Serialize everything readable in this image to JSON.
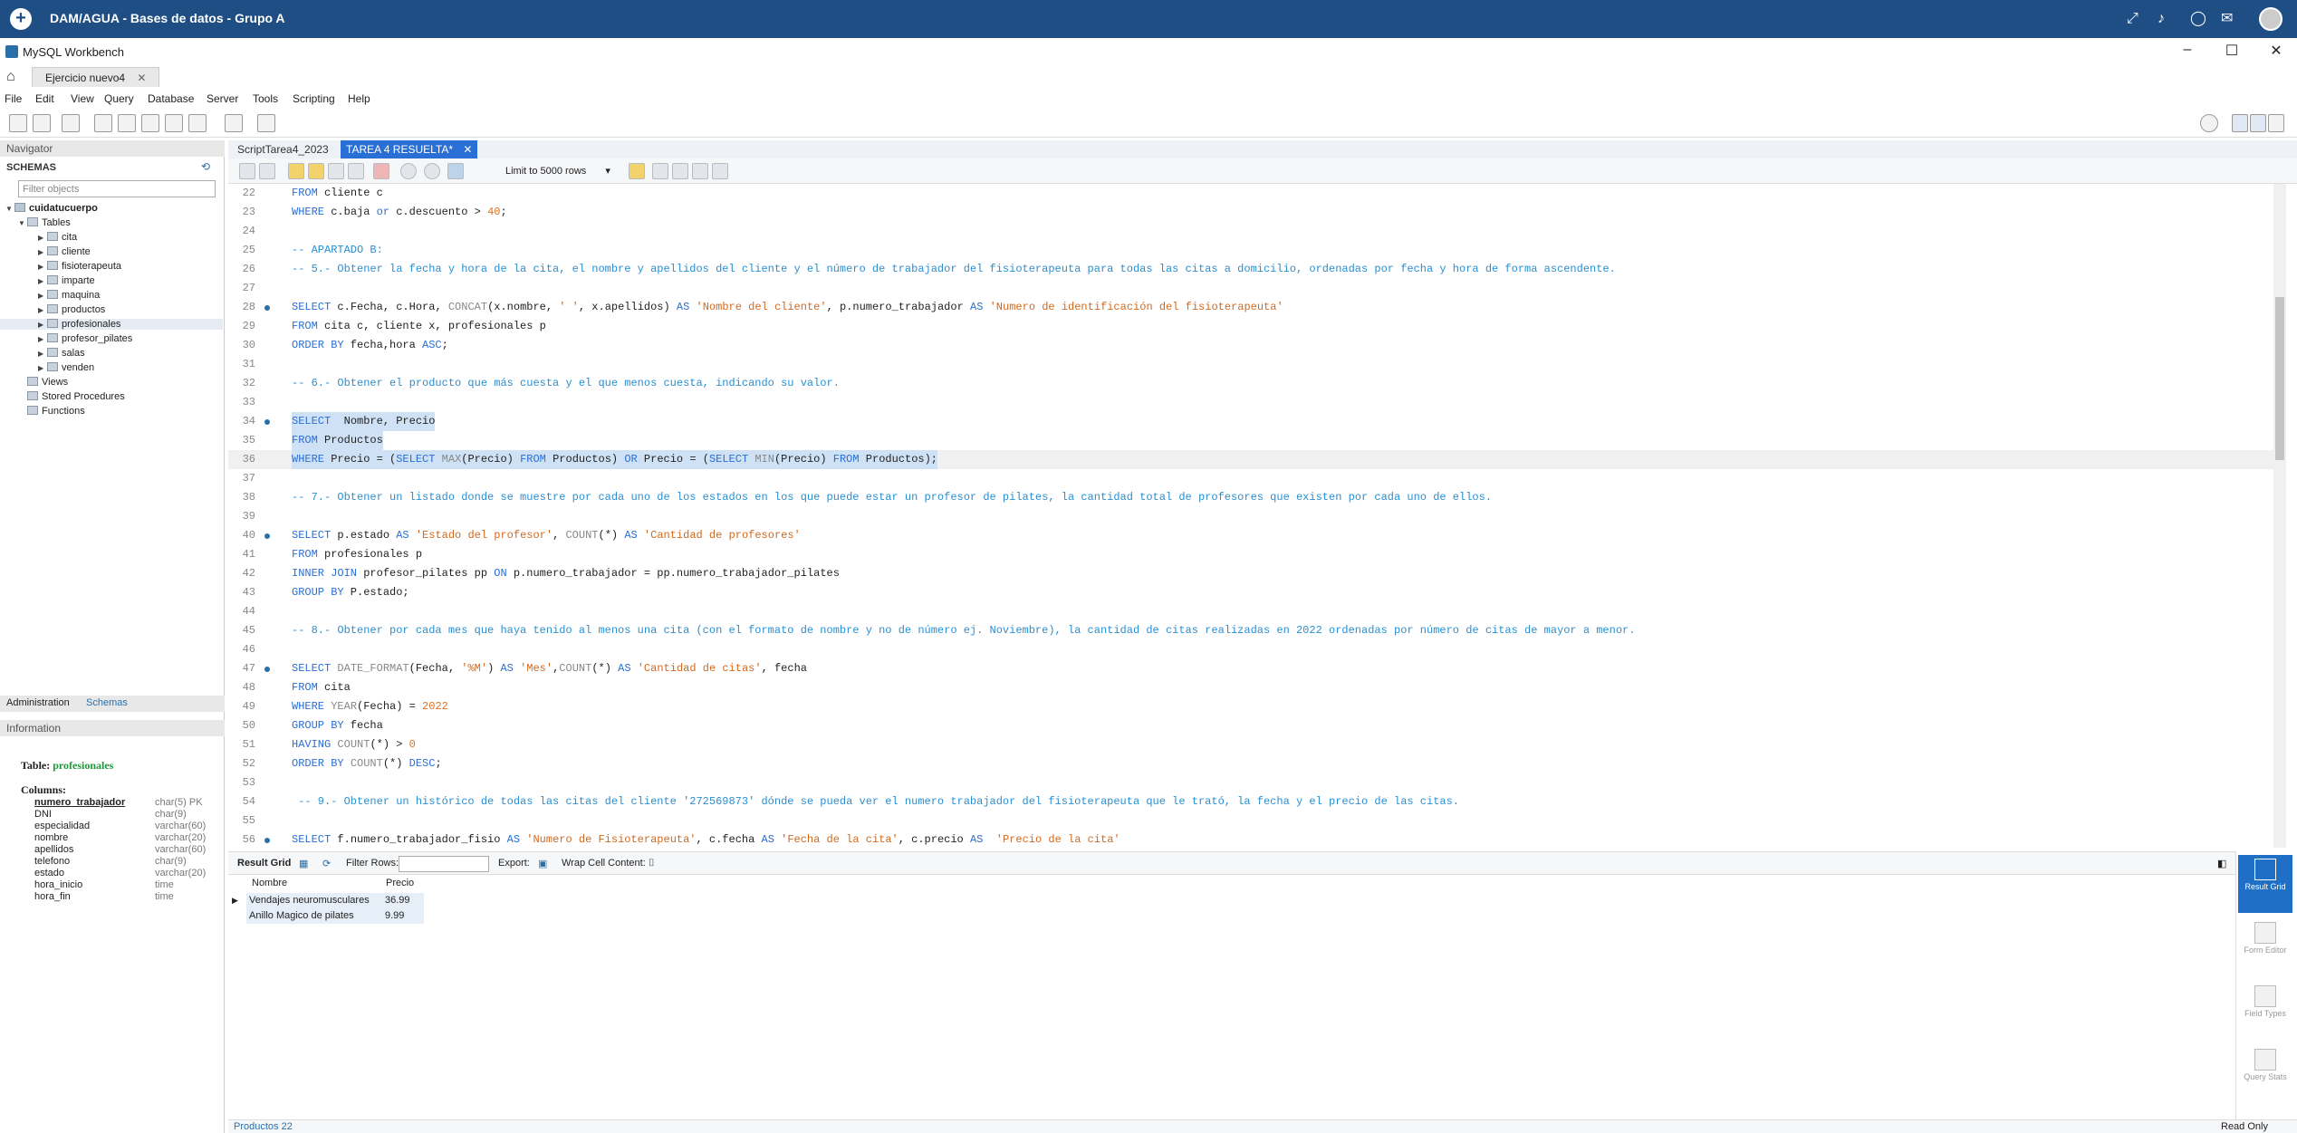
{
  "topbar": {
    "title": "DAM/AGUA - Bases de datos - Grupo A"
  },
  "window": {
    "app_title": "MySQL Workbench",
    "doc_tab": "Ejercicio nuevo4"
  },
  "menu": [
    "File",
    "Edit",
    "View",
    "Query",
    "Database",
    "Server",
    "Tools",
    "Scripting",
    "Help"
  ],
  "navigator": {
    "header": "Navigator",
    "schemas_title": "SCHEMAS",
    "filter_placeholder": "Filter objects",
    "schema": "cuidatucuerpo",
    "tables_label": "Tables",
    "tables": [
      "cita",
      "cliente",
      "fisioterapeuta",
      "imparte",
      "maquina",
      "productos",
      "profesionales",
      "profesor_pilates",
      "salas",
      "venden"
    ],
    "views": "Views",
    "procedures": "Stored Procedures",
    "functions": "Functions"
  },
  "panel_tabs": {
    "administration": "Administration",
    "schemas": "Schemas",
    "information": "Information"
  },
  "info": {
    "table_label": "Table:",
    "table_name": "profesionales",
    "columns_label": "Columns:",
    "columns": [
      {
        "name": "numero_trabajador",
        "type": "char(5) PK"
      },
      {
        "name": "DNI",
        "type": "char(9)"
      },
      {
        "name": "especialidad",
        "type": "varchar(60)"
      },
      {
        "name": "nombre",
        "type": "varchar(20)"
      },
      {
        "name": "apellidos",
        "type": "varchar(60)"
      },
      {
        "name": "telefono",
        "type": "char(9)"
      },
      {
        "name": "estado",
        "type": "varchar(20)"
      },
      {
        "name": "hora_inicio",
        "type": "time"
      },
      {
        "name": "hora_fin",
        "type": "time"
      }
    ]
  },
  "editor_tabs": [
    "ScriptTarea4_2023",
    "TAREA 4 RESUELTA*"
  ],
  "editor_toolbar": {
    "limit": "Limit to 5000 rows"
  },
  "code_lines": [
    {
      "n": "22",
      "dot": false,
      "t": "FROM cliente c"
    },
    {
      "n": "23",
      "dot": false,
      "t": "WHERE c.baja or c.descuento > 40;"
    },
    {
      "n": "24",
      "dot": false,
      "t": ""
    },
    {
      "n": "25",
      "dot": false,
      "t": "-- APARTADO B:"
    },
    {
      "n": "26",
      "dot": false,
      "t": "-- 5.- Obtener la fecha y hora de la cita, el nombre y apellidos del cliente y el número de trabajador del fisioterapeuta para todas las citas a domicilio, ordenadas por fecha y hora de forma ascendente."
    },
    {
      "n": "27",
      "dot": false,
      "t": ""
    },
    {
      "n": "28",
      "dot": true,
      "t": "SELECT c.Fecha, c.Hora, CONCAT(x.nombre, ' ', x.apellidos) AS 'Nombre del cliente', p.numero_trabajador AS 'Numero de identificación del fisioterapeuta'"
    },
    {
      "n": "29",
      "dot": false,
      "t": "FROM cita c, cliente x, profesionales p"
    },
    {
      "n": "30",
      "dot": false,
      "t": "ORDER BY fecha,hora ASC;"
    },
    {
      "n": "31",
      "dot": false,
      "t": ""
    },
    {
      "n": "32",
      "dot": false,
      "t": "-- 6.- Obtener el producto que más cuesta y el que menos cuesta, indicando su valor."
    },
    {
      "n": "33",
      "dot": false,
      "t": ""
    },
    {
      "n": "34",
      "dot": true,
      "t": "SELECT  Nombre, Precio"
    },
    {
      "n": "35",
      "dot": false,
      "t": "FROM Productos"
    },
    {
      "n": "36",
      "dot": false,
      "t": "WHERE Precio = (SELECT MAX(Precio) FROM Productos) OR Precio = (SELECT MIN(Precio) FROM Productos);"
    },
    {
      "n": "37",
      "dot": false,
      "t": ""
    },
    {
      "n": "38",
      "dot": false,
      "t": "-- 7.- Obtener un listado donde se muestre por cada uno de los estados en los que puede estar un profesor de pilates, la cantidad total de profesores que existen por cada uno de ellos."
    },
    {
      "n": "39",
      "dot": false,
      "t": ""
    },
    {
      "n": "40",
      "dot": true,
      "t": "SELECT p.estado AS 'Estado del profesor', COUNT(*) AS 'Cantidad de profesores'"
    },
    {
      "n": "41",
      "dot": false,
      "t": "FROM profesionales p"
    },
    {
      "n": "42",
      "dot": false,
      "t": "INNER JOIN profesor_pilates pp ON p.numero_trabajador = pp.numero_trabajador_pilates"
    },
    {
      "n": "43",
      "dot": false,
      "t": "GROUP BY P.estado;"
    },
    {
      "n": "44",
      "dot": false,
      "t": ""
    },
    {
      "n": "45",
      "dot": false,
      "t": "-- 8.- Obtener por cada mes que haya tenido al menos una cita (con el formato de nombre y no de número ej. Noviembre), la cantidad de citas realizadas en 2022 ordenadas por número de citas de mayor a menor."
    },
    {
      "n": "46",
      "dot": false,
      "t": ""
    },
    {
      "n": "47",
      "dot": true,
      "t": "SELECT DATE_FORMAT(Fecha, '%M') AS 'Mes',COUNT(*) AS 'Cantidad de citas', fecha"
    },
    {
      "n": "48",
      "dot": false,
      "t": "FROM cita"
    },
    {
      "n": "49",
      "dot": false,
      "t": "WHERE YEAR(Fecha) = 2022"
    },
    {
      "n": "50",
      "dot": false,
      "t": "GROUP BY fecha"
    },
    {
      "n": "51",
      "dot": false,
      "t": "HAVING COUNT(*) > 0"
    },
    {
      "n": "52",
      "dot": false,
      "t": "ORDER BY COUNT(*) DESC;"
    },
    {
      "n": "53",
      "dot": false,
      "t": ""
    },
    {
      "n": "54",
      "dot": false,
      "t": " -- 9.- Obtener un histórico de todas las citas del cliente '272569873' dónde se pueda ver el numero trabajador del fisioterapeuta que le trató, la fecha y el precio de las citas."
    },
    {
      "n": "55",
      "dot": false,
      "t": ""
    },
    {
      "n": "56",
      "dot": true,
      "t": "SELECT f.numero_trabajador_fisio AS 'Numero de Fisioterapeuta', c.fecha AS 'Fecha de la cita', c.precio AS  'Precio de la cita'"
    }
  ],
  "result_bar": {
    "result_grid": "Result Grid",
    "filter_rows": "Filter Rows:",
    "export": "Export:",
    "wrap": "Wrap Cell Content:"
  },
  "result": {
    "columns": [
      "Nombre",
      "Precio"
    ],
    "rows": [
      [
        "Vendajes neuromusculares",
        "36.99"
      ],
      [
        "Anillo Magico de pilates",
        "9.99"
      ]
    ]
  },
  "right_panel": [
    {
      "label": "Result Grid",
      "active": true
    },
    {
      "label": "Form Editor",
      "active": false
    },
    {
      "label": "Field Types",
      "active": false
    },
    {
      "label": "Query Stats",
      "active": false
    }
  ],
  "status": {
    "tab": "Productos 22",
    "read_only": "Read Only"
  }
}
